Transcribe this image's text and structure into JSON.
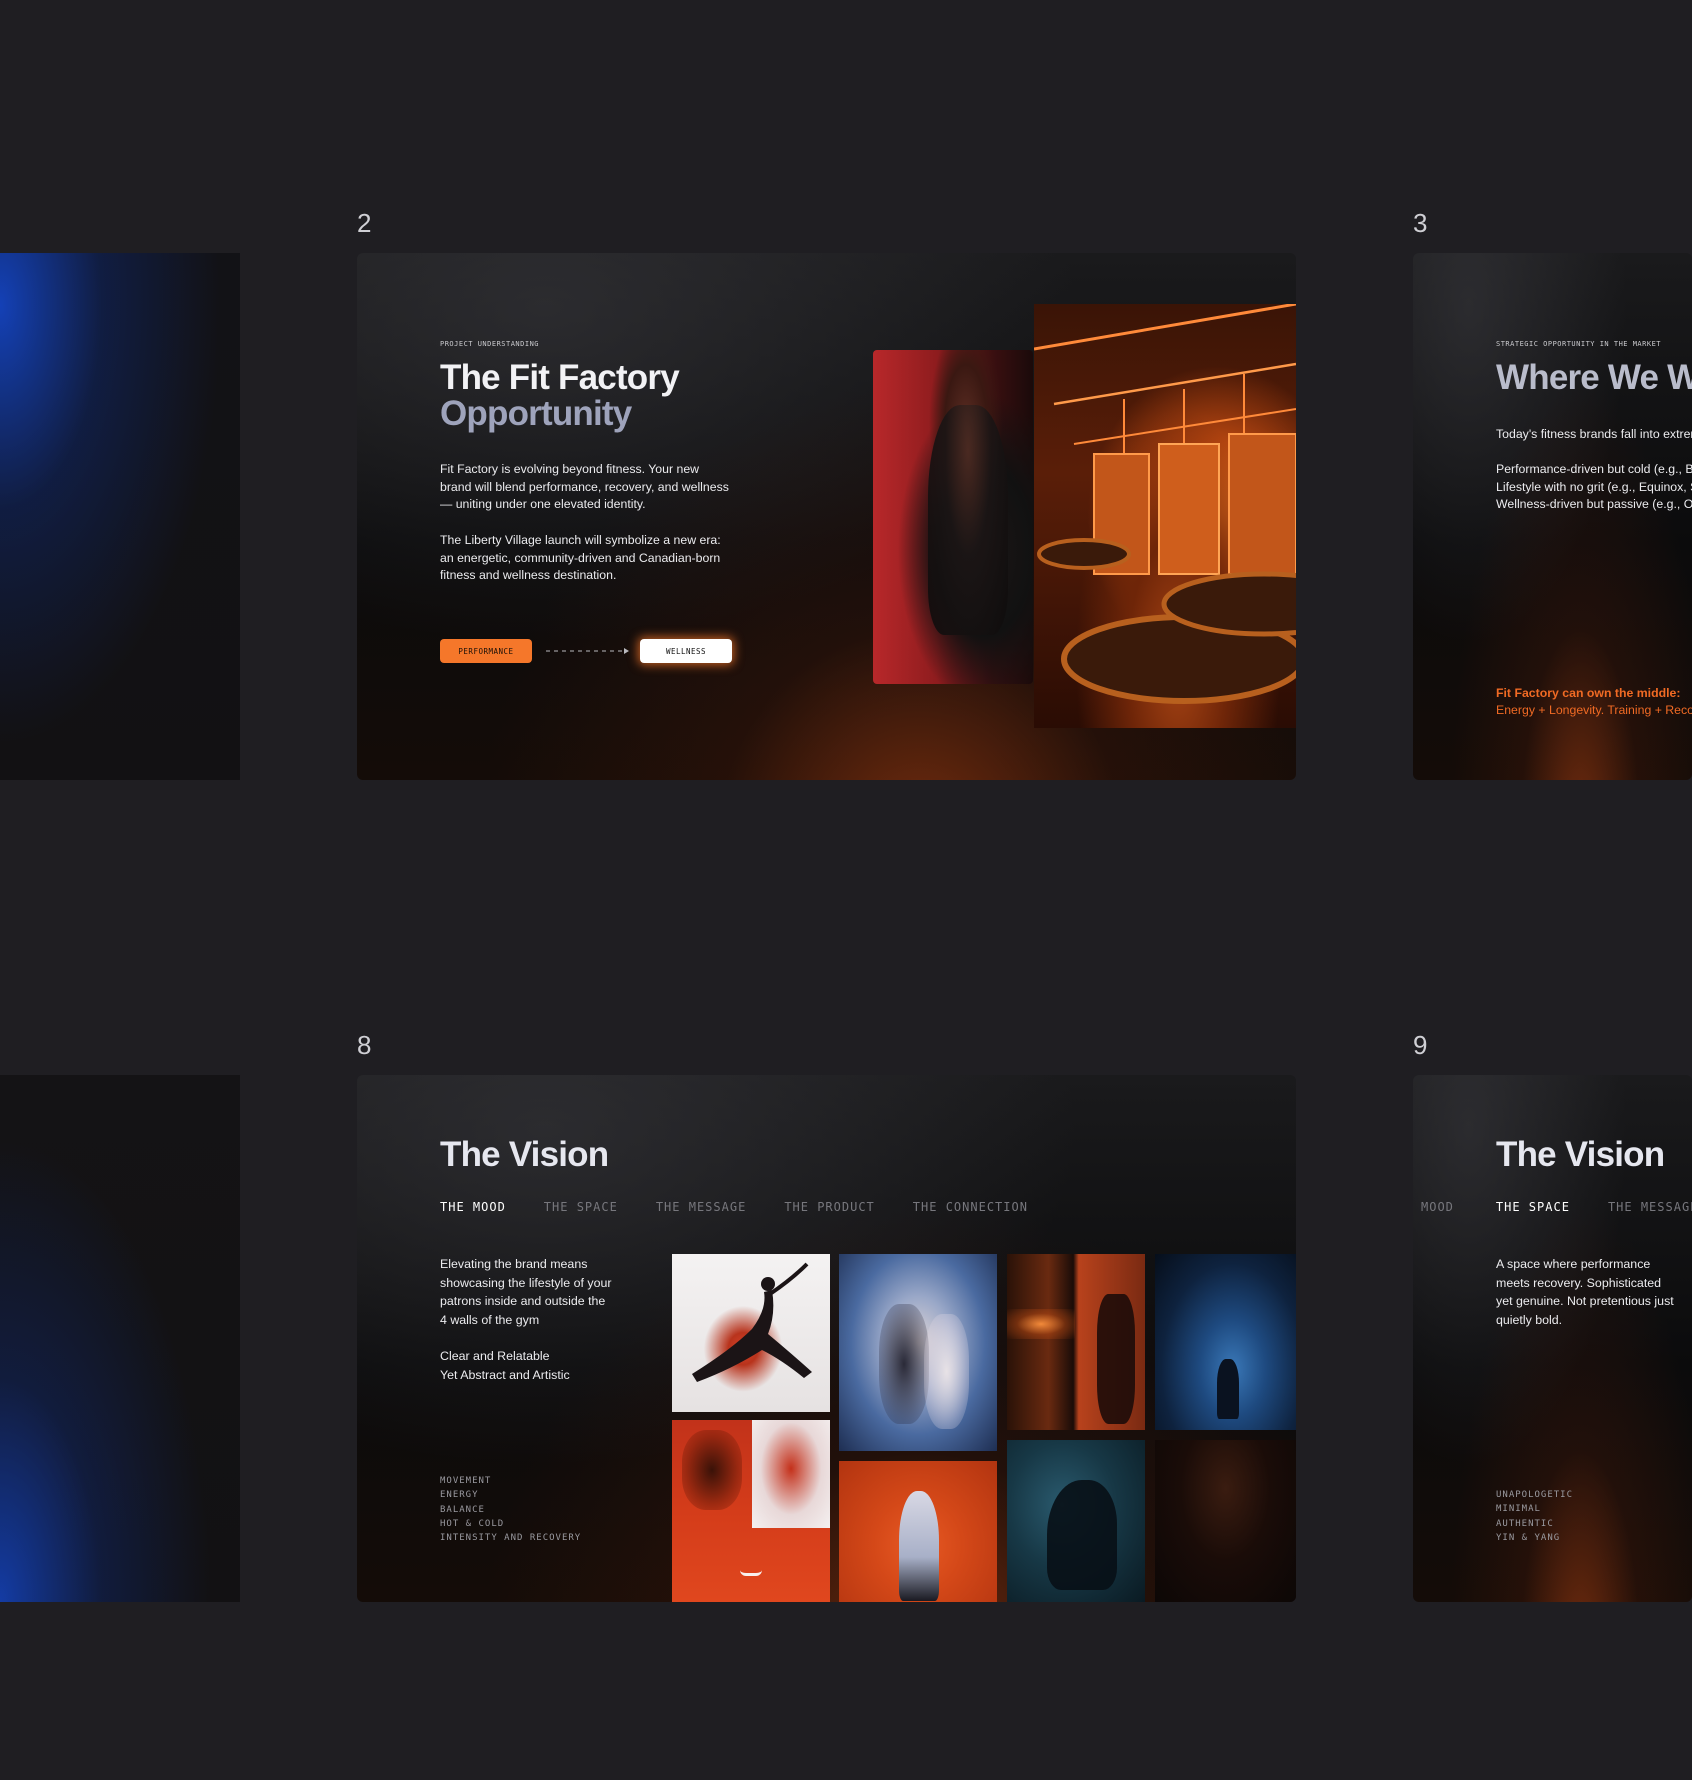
{
  "slides": [
    {
      "number": "2",
      "eyebrow": "PROJECT UNDERSTANDING",
      "title_line1": "The Fit Factory",
      "title_line2": "Opportunity",
      "paragraph1": "Fit Factory is evolving beyond fitness. Your new brand will blend performance, recovery, and wellness — uniting under one elevated identity.",
      "paragraph2": "The Liberty Village launch will symbolize a new era: an energetic, community-driven and Canadian-born fitness and wellness destination.",
      "pill_left": "PERFORMANCE",
      "pill_right": "WELLNESS"
    },
    {
      "number": "3",
      "eyebrow": "STRATEGIC OPPORTUNITY IN THE MARKET",
      "title": "Where We W",
      "intro": "Today's fitness brands fall into extrem",
      "lines": [
        "Performance-driven but cold (e.g., Ba",
        "Lifestyle with no grit (e.g., Equinox, S",
        "Wellness-driven but passive (e.g., Ot"
      ],
      "highlight_title": "Fit Factory can own the middle:",
      "highlight_text": "Energy + Longevity. Training + Recov"
    },
    {
      "number": "8",
      "title": "The Vision",
      "tabs": [
        "THE MOOD",
        "THE SPACE",
        "THE MESSAGE",
        "THE PRODUCT",
        "THE CONNECTION"
      ],
      "active_tab": "THE MOOD",
      "paragraph1": "Elevating the brand means showcasing the lifestyle of your patrons inside and outside the 4 walls of the gym",
      "paragraph2_line1": "Clear and Relatable",
      "paragraph2_line2": "Yet Abstract and Artistic",
      "keywords": [
        "MOVEMENT",
        "ENERGY",
        "BALANCE",
        "HOT & COLD",
        "INTENSITY AND RECOVERY"
      ]
    },
    {
      "number": "9",
      "title": "The Vision",
      "tabs": [
        "MOOD",
        "THE SPACE",
        "THE MESSAGE"
      ],
      "active_tab": "THE SPACE",
      "paragraph": "A space where performance meets recovery. Sophisticated yet genuine. Not pretentious just quietly bold.",
      "keywords": [
        "UNAPOLOGETIC",
        "MINIMAL",
        "AUTHENTIC",
        "YIN & YANG"
      ]
    }
  ],
  "colors": {
    "background": "#1f1e22",
    "accent_orange": "#f5772a",
    "title_accent": "#9ea3bb",
    "highlight_orange": "#f06a24"
  }
}
